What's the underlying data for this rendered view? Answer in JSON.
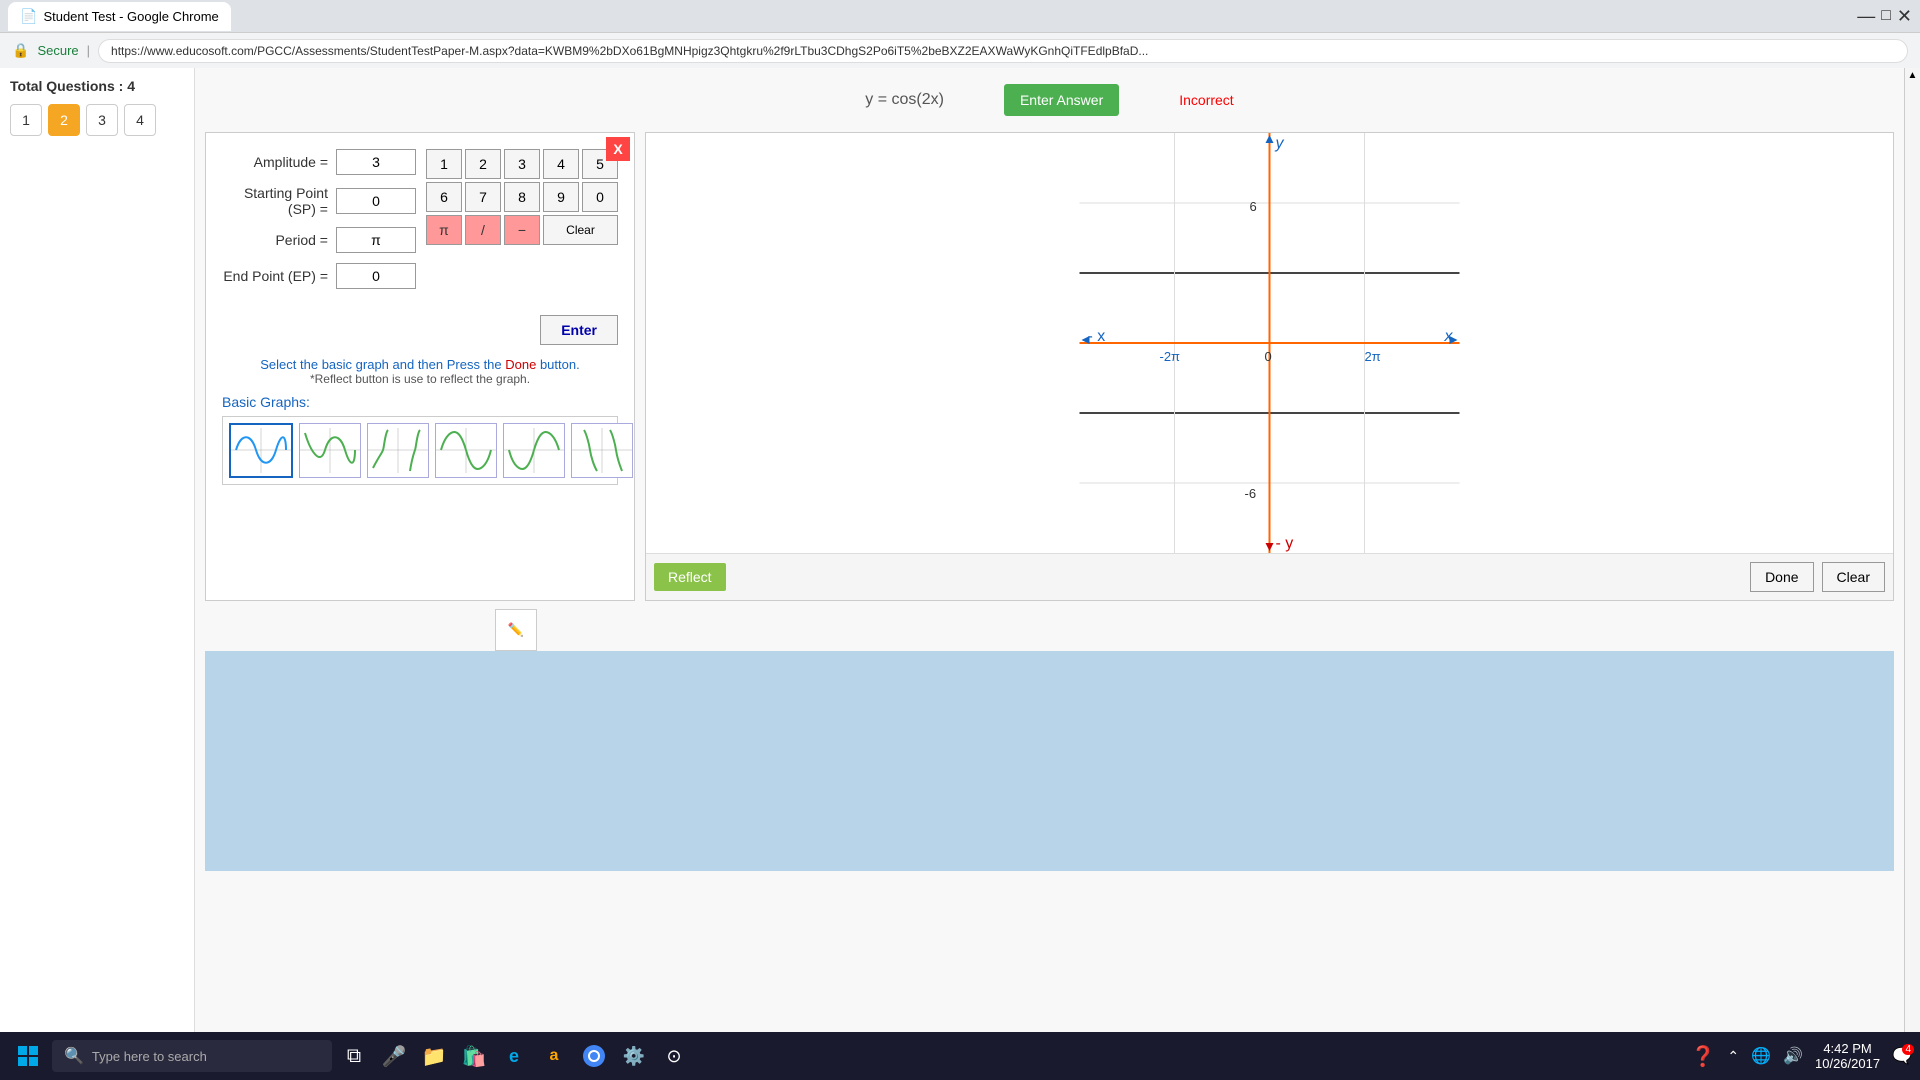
{
  "window": {
    "title": "Student Test - Google Chrome",
    "url": "https://www.educosoft.com/PGCC/Assessments/StudentTestPaper-M.aspx?data=KWBM9%2bDXo61BgMNHpigz3Qhtgkru%2f9rLTbu3CDhgS2Po6iT5%2beBXZ2EAXWaWyKGnhQiTFEdlpBfaD...",
    "secure_label": "Secure"
  },
  "sidebar": {
    "total_questions_label": "Total Questions : 4",
    "questions": [
      {
        "number": "1",
        "active": false
      },
      {
        "number": "2",
        "active": true
      },
      {
        "number": "3",
        "active": false
      },
      {
        "number": "4",
        "active": false
      }
    ]
  },
  "equation_bar": {
    "equation": "y = cos(2x)",
    "enter_answer_label": "Enter Answer",
    "incorrect_label": "Incorrect"
  },
  "input_form": {
    "amplitude_label": "Amplitude =",
    "amplitude_value": "3",
    "starting_point_label": "Starting Point (SP) =",
    "starting_point_value": "0",
    "period_label": "Period =",
    "period_value": "π",
    "end_point_label": "End Point (EP) =",
    "end_point_value": "0",
    "close_label": "X",
    "keypad": {
      "row1": [
        "1",
        "2",
        "3",
        "4",
        "5"
      ],
      "row2": [
        "6",
        "7",
        "8",
        "9",
        "0"
      ],
      "special": [
        "π",
        "/",
        "−",
        "Clear"
      ]
    },
    "enter_button_label": "Enter"
  },
  "instruction": {
    "line1_start": "Select the basic graph and then Press the ",
    "done_word": "Done",
    "line1_end": " button.",
    "line2": "*Reflect button is use to reflect the graph."
  },
  "basic_graphs": {
    "label": "Basic Graphs:",
    "graphs": [
      {
        "id": 1,
        "type": "sine",
        "selected": true
      },
      {
        "id": 2,
        "type": "cosine",
        "selected": false
      },
      {
        "id": 3,
        "type": "tangent",
        "selected": false
      },
      {
        "id": 4,
        "type": "cosecant",
        "selected": false
      },
      {
        "id": 5,
        "type": "secant",
        "selected": false
      },
      {
        "id": 6,
        "type": "cotangent",
        "selected": false
      }
    ]
  },
  "graph": {
    "y_max": "6",
    "y_min": "-6",
    "x_label": "x",
    "neg_x_label": "- x",
    "y_label": "y",
    "neg_y_label": "- y",
    "x_pos_label": "2π",
    "x_neg_label": "-2π",
    "origin_label": "0",
    "reflect_button": "Reflect",
    "done_button": "Done",
    "clear_button": "Clear"
  },
  "taskbar": {
    "search_placeholder": "Type here to search",
    "time": "4:42 PM",
    "date": "10/26/2017"
  }
}
